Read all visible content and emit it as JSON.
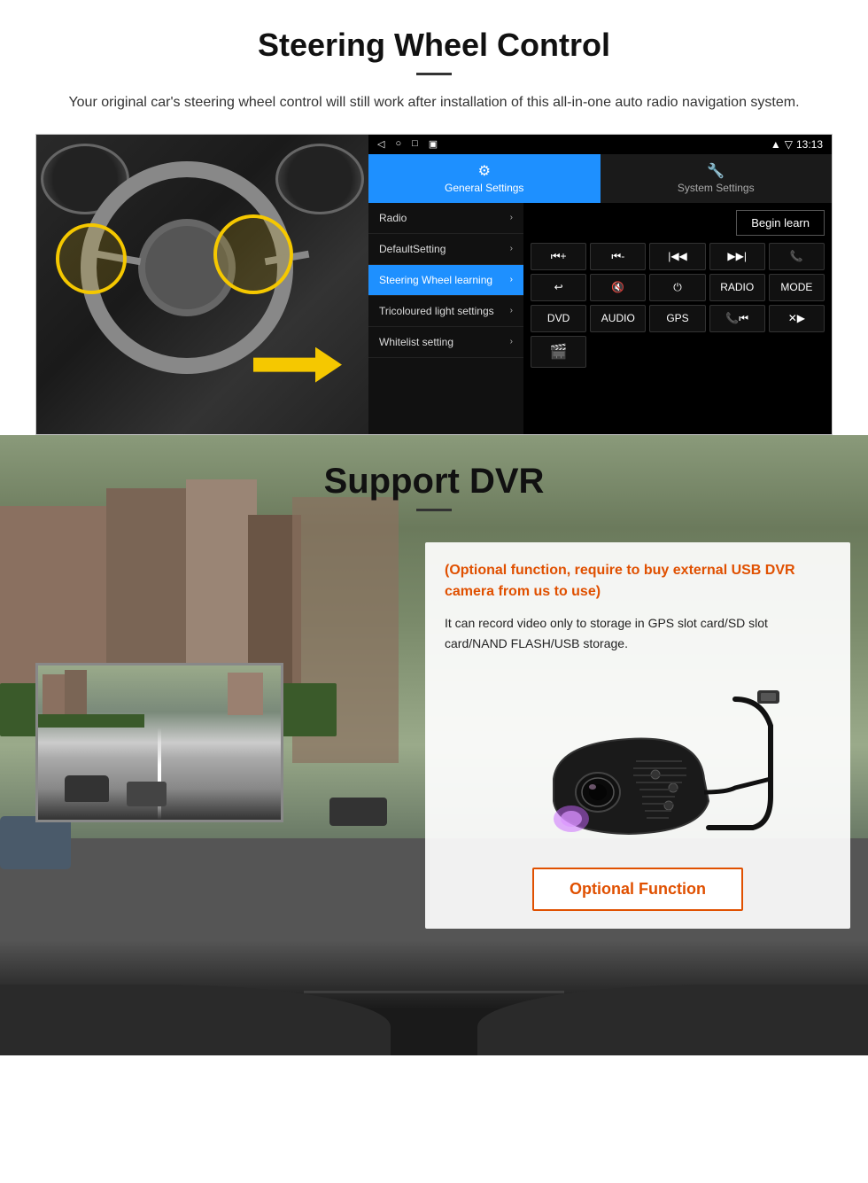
{
  "section1": {
    "title": "Steering Wheel Control",
    "description": "Your original car's steering wheel control will still work after installation of this all-in-one auto radio navigation system.",
    "android_ui": {
      "status_bar": {
        "time": "13:13",
        "icons": [
          "signal",
          "wifi"
        ]
      },
      "tabs": [
        {
          "label": "General Settings",
          "active": true
        },
        {
          "label": "System Settings",
          "active": false
        }
      ],
      "menu_items": [
        {
          "label": "Radio",
          "active": false
        },
        {
          "label": "DefaultSetting",
          "active": false
        },
        {
          "label": "Steering Wheel learning",
          "active": true
        },
        {
          "label": "Tricoloured light settings",
          "active": false
        },
        {
          "label": "Whitelist setting",
          "active": false
        }
      ],
      "begin_learn_label": "Begin learn",
      "control_buttons": [
        "⏮+",
        "⏮-",
        "⏮|",
        "|⏭",
        "📞",
        "↩",
        "🔇",
        "⏻",
        "RADIO",
        "MODE",
        "DVD",
        "AUDIO",
        "GPS",
        "📞⏮|",
        "✕⏭"
      ]
    }
  },
  "section2": {
    "title": "Support DVR",
    "info_box": {
      "optional_title": "(Optional function, require to buy external USB DVR camera from us to use)",
      "description": "It can record video only to storage in GPS slot card/SD slot card/NAND FLASH/USB storage.",
      "optional_button_label": "Optional Function"
    }
  }
}
